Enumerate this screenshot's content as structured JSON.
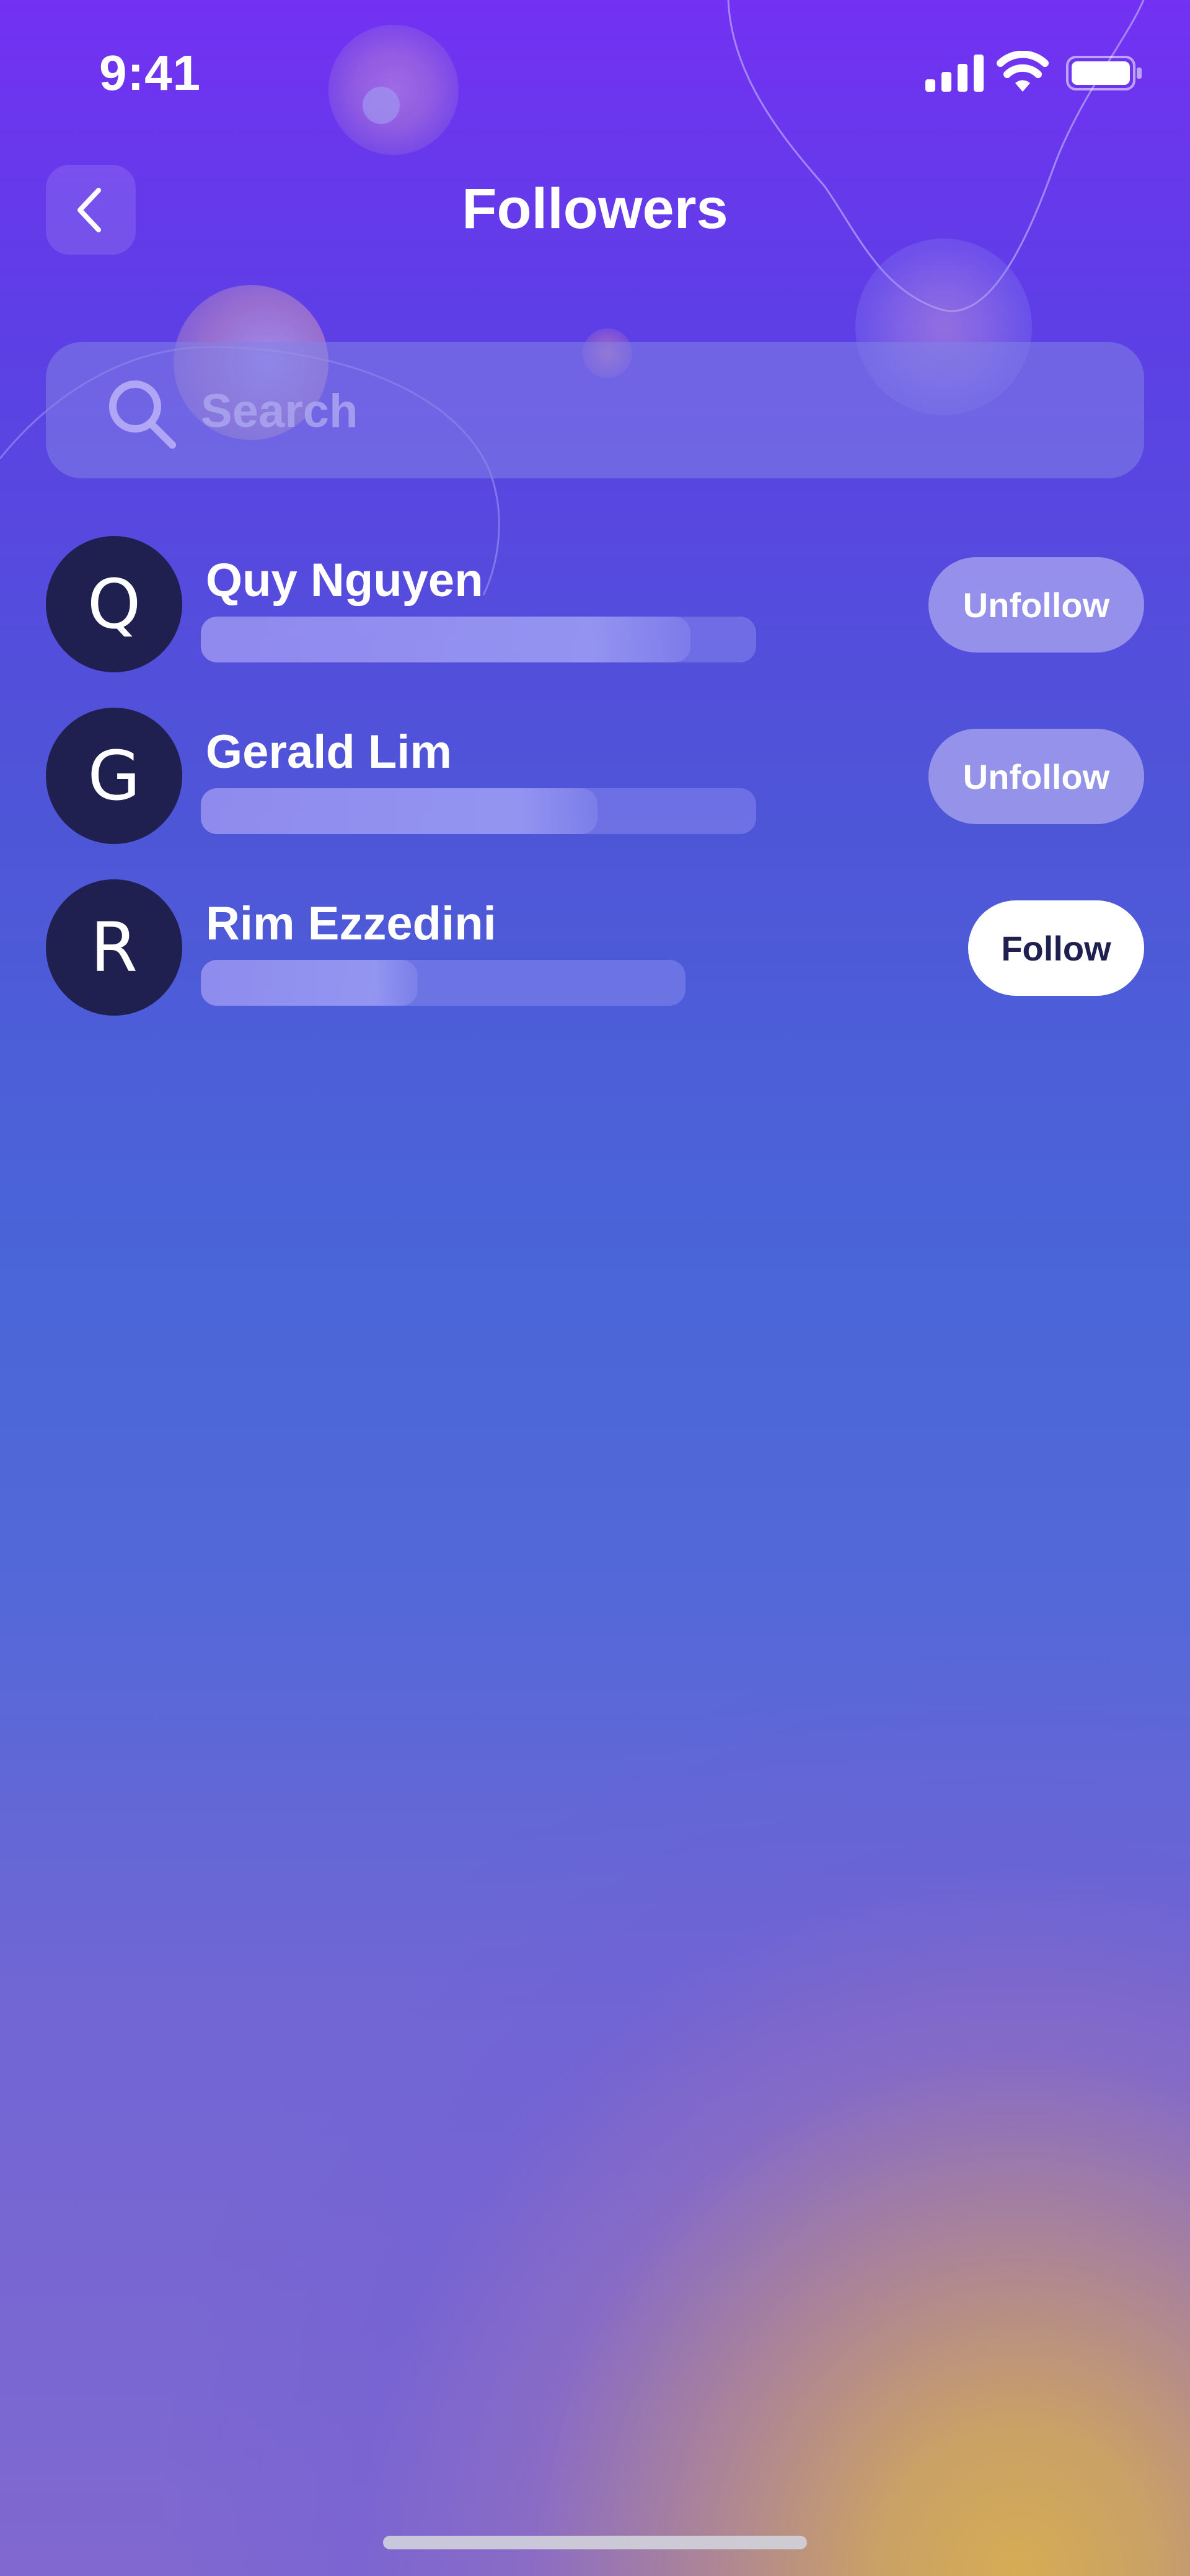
{
  "status_bar": {
    "time": "9:41",
    "icons": [
      "signal-icon",
      "wifi-icon",
      "battery-icon"
    ]
  },
  "header": {
    "title": "Followers",
    "back_icon": "chevron-left-icon"
  },
  "search": {
    "placeholder": "Search",
    "value": "",
    "icon": "search-icon"
  },
  "followers": [
    {
      "initial": "Q",
      "name": "Quy Nguyen",
      "action": "Unfollow",
      "following": true
    },
    {
      "initial": "G",
      "name": "Gerald Lim",
      "action": "Unfollow",
      "following": true
    },
    {
      "initial": "R",
      "name": "Rim Ezzedini",
      "action": "Follow",
      "following": false
    }
  ],
  "colors": {
    "avatar_bg": "#1f1f50",
    "follow_button_bg": "#ffffff",
    "follow_button_text": "#1f1f50",
    "gradient_top": "#7331f3",
    "gradient_mid": "#4a66d8",
    "gradient_bottom_glow": "#d6ac54"
  }
}
